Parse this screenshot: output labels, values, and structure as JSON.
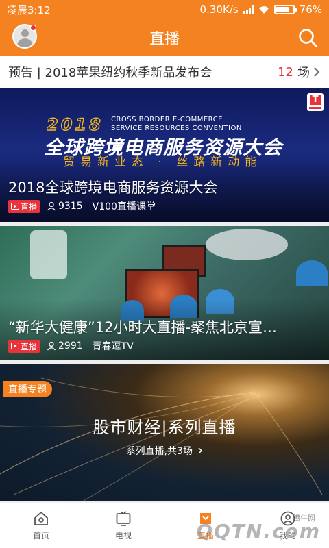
{
  "status_bar": {
    "time": "凌晨3:12",
    "speed": "0.30K/s",
    "battery": "76%",
    "battery_fraction": 0.76
  },
  "app_bar": {
    "title": "直播"
  },
  "preview": {
    "text": "预告 | 2018苹果纽约秋季新品发布会",
    "count": "12",
    "unit": "场"
  },
  "cards": [
    {
      "banner": {
        "year": "2018",
        "en_line1": "CROSS BORDER E-COMMERCE",
        "en_line2": "SERVICE RESOURCES CONVENTION",
        "cn_title": "全球跨境电商服务资源大会",
        "slogan": "贸易新业态 · 丝路新动能"
      },
      "title": "2018全球跨境电商服务资源大会",
      "live_label": "直播",
      "viewers": "9315",
      "channel": "V100直播课堂"
    },
    {
      "title": "“新华大健康”12小时大直播-聚焦北京宣…",
      "live_label": "直播",
      "viewers": "2991",
      "channel": "青春逗TV"
    }
  ],
  "topic": {
    "tag": "直播专题",
    "title": "股市财经|系列直播",
    "subtitle": "系列直播,共3场"
  },
  "tabs": [
    {
      "label": "首页",
      "icon": "home-icon"
    },
    {
      "label": "电视",
      "icon": "tv-icon"
    },
    {
      "label": "直播",
      "icon": "live-icon"
    },
    {
      "label": "我的",
      "icon": "user-icon"
    }
  ],
  "watermark": {
    "text": "QQTN.com",
    "label": "腾牛网"
  },
  "colors": {
    "accent": "#f58220",
    "live_red": "#e8323c"
  }
}
